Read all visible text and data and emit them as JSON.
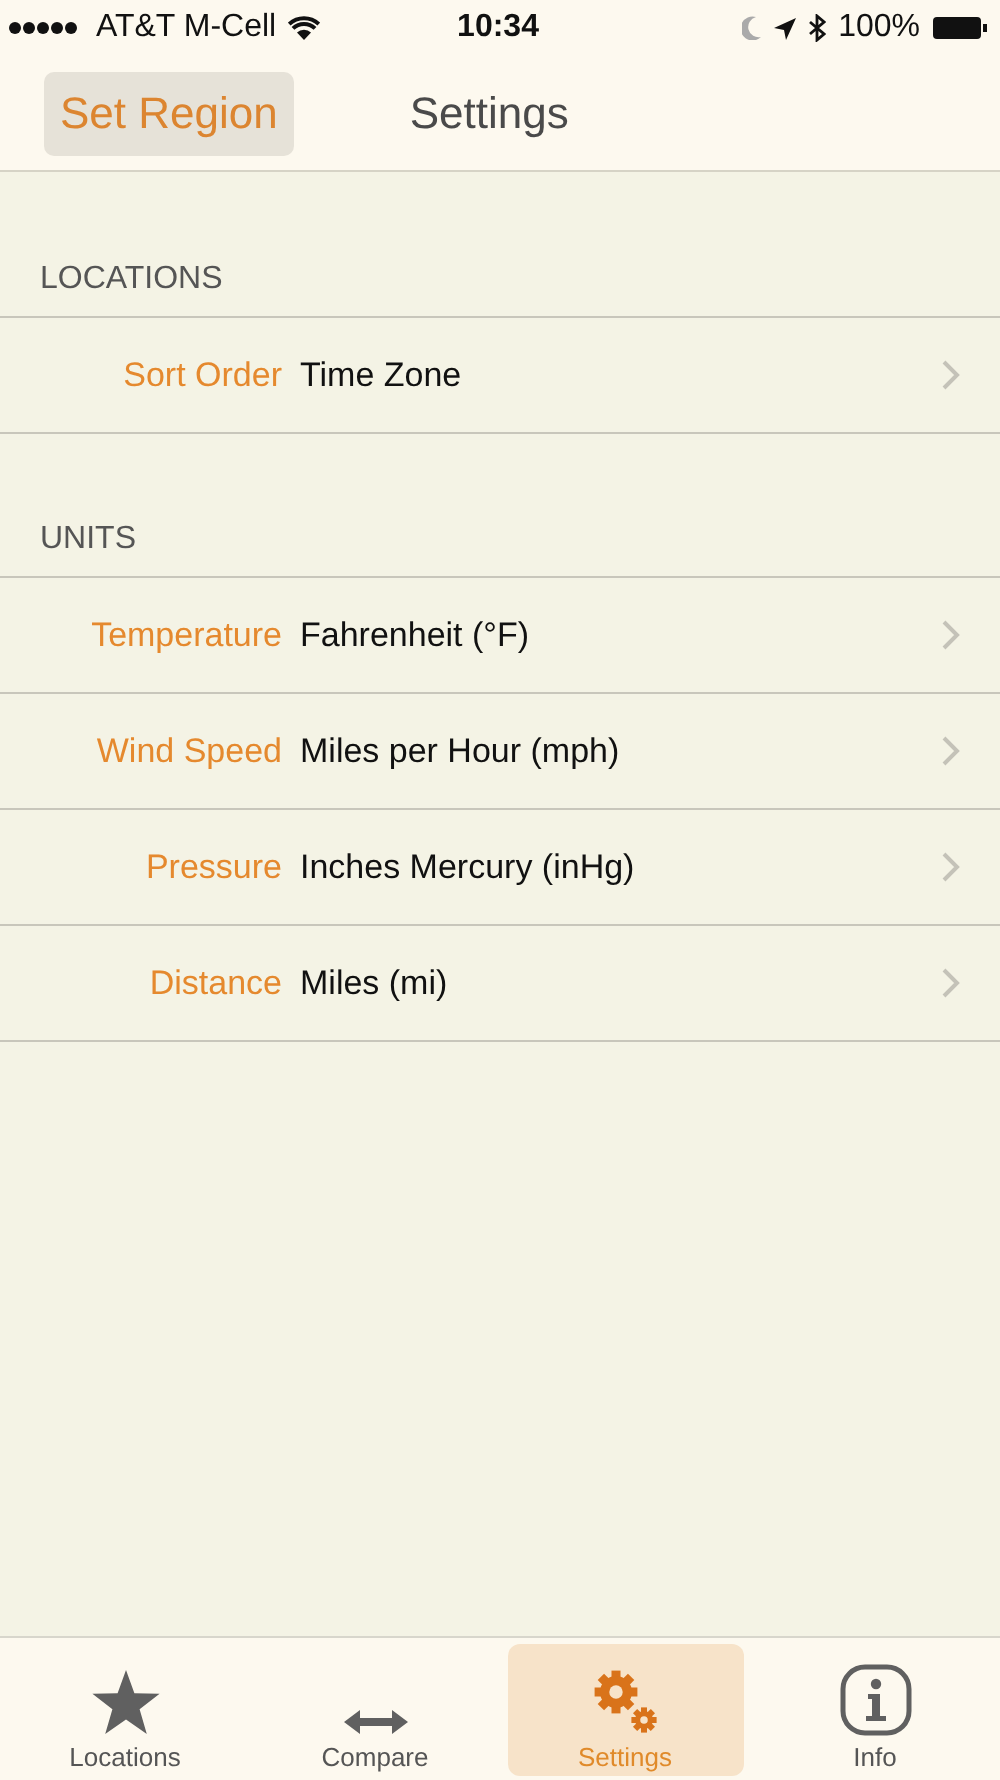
{
  "status_bar": {
    "carrier": "AT&T M-Cell",
    "time": "10:34",
    "battery": "100%"
  },
  "nav_bar": {
    "back_button": "Set Region",
    "title": "Settings"
  },
  "sections": [
    {
      "header": "LOCATIONS",
      "rows": [
        {
          "label": "Sort Order",
          "value": "Time Zone"
        }
      ]
    },
    {
      "header": "UNITS",
      "rows": [
        {
          "label": "Temperature",
          "value": "Fahrenheit (°F)"
        },
        {
          "label": "Wind Speed",
          "value": "Miles per Hour (mph)"
        },
        {
          "label": "Pressure",
          "value": "Inches Mercury (inHg)"
        },
        {
          "label": "Distance",
          "value": "Miles (mi)"
        }
      ]
    }
  ],
  "tab_bar": [
    {
      "label": "Locations",
      "kind": "star",
      "selected": false
    },
    {
      "label": "Compare",
      "kind": "arrows",
      "selected": false
    },
    {
      "label": "Settings",
      "kind": "gears",
      "selected": true
    },
    {
      "label": "Info",
      "kind": "info",
      "selected": false
    }
  ]
}
